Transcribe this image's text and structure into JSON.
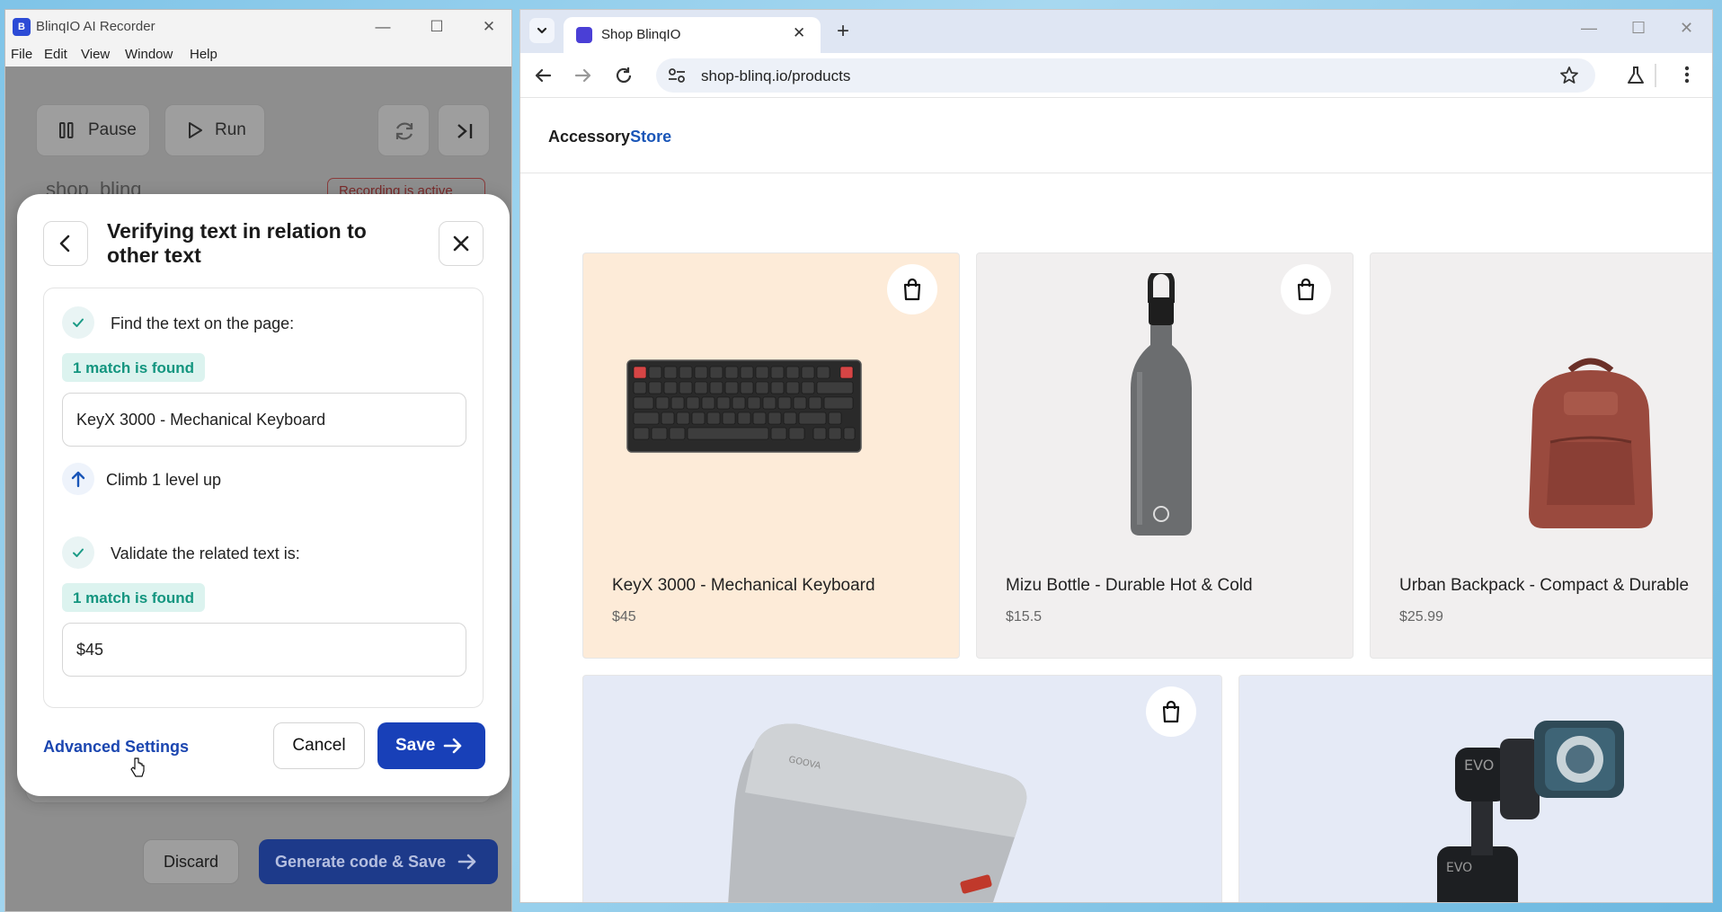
{
  "recorder": {
    "title": "BlinqIO AI Recorder",
    "menu": [
      "File",
      "Edit",
      "View",
      "Window",
      "Help"
    ],
    "pause_label": "Pause",
    "run_label": "Run",
    "url_partial": "shop_blinq",
    "recording_partial": "Recording is active",
    "discard_label": "Discard",
    "generate_label": "Generate code & Save"
  },
  "modal": {
    "title": "Verifying text in relation to other text",
    "step1_label": "Find the text on the page:",
    "step1_match": "1 match is found",
    "step1_value": "KeyX 3000 - Mechanical Keyboard",
    "climb_label": "Climb 1 level up",
    "step2_label": "Validate the related text is:",
    "step2_match": "1 match is found",
    "step2_value": "$45",
    "advanced_label": "Advanced Settings",
    "cancel_label": "Cancel",
    "save_label": "Save"
  },
  "browser": {
    "tab_title": "Shop BlinqIO",
    "url": "shop-blinq.io/products",
    "brand_main": "Accessory",
    "brand_accent": "Store",
    "products": [
      {
        "name": "KeyX 3000 - Mechanical Keyboard",
        "price": "$45"
      },
      {
        "name": "Mizu Bottle - Durable Hot & Cold",
        "price": "$15.5"
      },
      {
        "name": "Urban Backpack - Compact & Durable",
        "price": "$25.99"
      }
    ],
    "gadget_text": "GOOVA",
    "gimbal_text": "EVO"
  },
  "colors": {
    "accent": "#1840b8",
    "match_badge": "#13957f",
    "keyboard_card": "#fdebd8",
    "neutral_card": "#f1efef",
    "powerbank_card": "#e5eaf6"
  }
}
